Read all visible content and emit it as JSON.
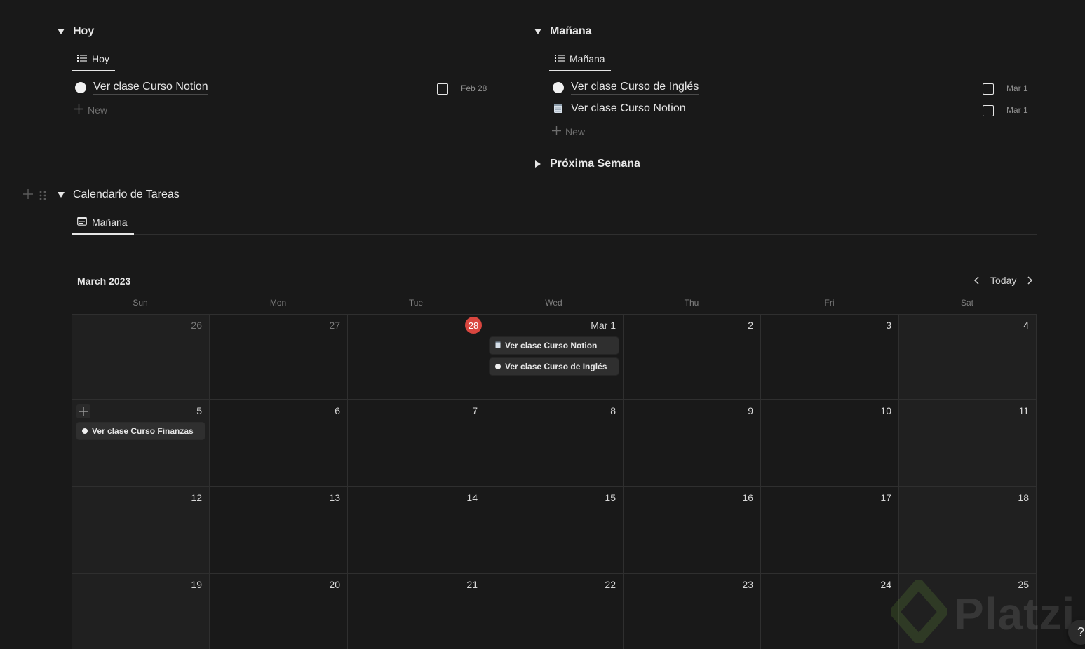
{
  "hoy": {
    "title": "Hoy",
    "tab_label": "Hoy",
    "items": [
      {
        "title": "Ver clase Curso Notion",
        "date": "Feb 28"
      }
    ],
    "new_label": "New"
  },
  "manana": {
    "title": "Mañana",
    "tab_label": "Mañana",
    "items": [
      {
        "title": "Ver clase Curso de Inglés",
        "date": "Mar 1"
      },
      {
        "title": "Ver clase Curso Notion",
        "date": "Mar 1"
      }
    ],
    "new_label": "New"
  },
  "proxima": {
    "title": "Próxima Semana"
  },
  "calendar": {
    "title": "Calendario de Tareas",
    "tab_label": "Mañana",
    "month_label": "March 2023",
    "today_label": "Today",
    "weekdays": [
      "Sun",
      "Mon",
      "Tue",
      "Wed",
      "Thu",
      "Fri",
      "Sat"
    ],
    "weeks": [
      [
        "26",
        "27",
        "28",
        "Mar 1",
        "2",
        "3",
        "4"
      ],
      [
        "5",
        "6",
        "7",
        "8",
        "9",
        "10",
        "11"
      ],
      [
        "12",
        "13",
        "14",
        "15",
        "16",
        "17",
        "18"
      ],
      [
        "19",
        "20",
        "21",
        "22",
        "23",
        "24",
        "25"
      ]
    ],
    "today_day": "28",
    "muted_days": [
      "26",
      "27"
    ],
    "events": [
      {
        "week": 0,
        "day": 3,
        "title": "Ver clase Curso Notion",
        "icon": "notepad-icon"
      },
      {
        "week": 0,
        "day": 3,
        "title": "Ver clase Curso de Inglés",
        "icon": "circle-icon"
      },
      {
        "week": 1,
        "day": 0,
        "title": "Ver clase Curso Finanzas",
        "icon": "circle-icon"
      }
    ]
  },
  "watermark": {
    "text": "Platzi"
  },
  "help": {
    "label": "?"
  },
  "colors": {
    "background": "#191919",
    "today_badge": "#d9463f",
    "event_bg": "#2f2f2f"
  }
}
